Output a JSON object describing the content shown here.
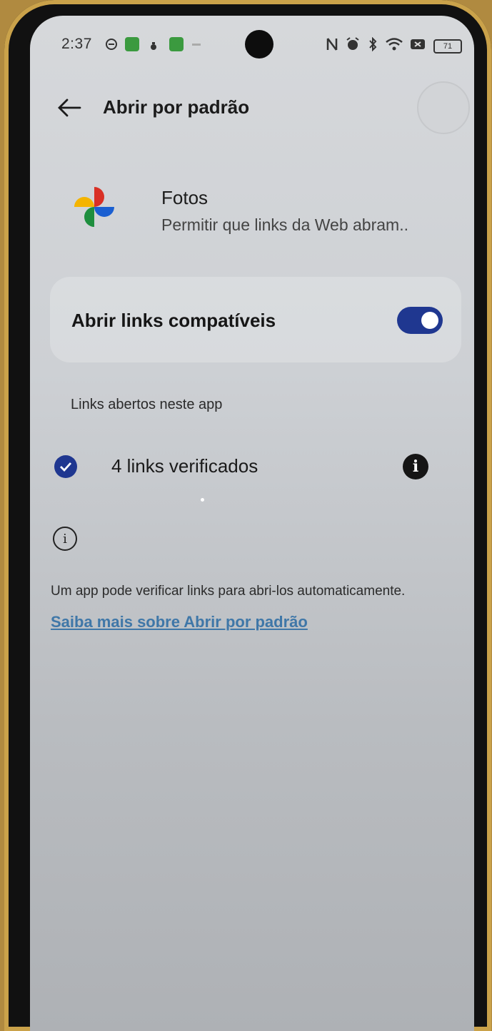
{
  "status_bar": {
    "time": "2:37",
    "battery": "71",
    "icons": [
      "notification-icon",
      "app-green-icon",
      "alarm-small-icon",
      "app-green-icon",
      "nfc-icon",
      "alarm-clock-icon",
      "bluetooth-icon",
      "wifi-icon",
      "data-icon",
      "battery-icon"
    ]
  },
  "app_bar": {
    "title": "Abrir por padrão",
    "back_icon": "arrow-left-icon"
  },
  "app": {
    "name": "Fotos",
    "description": "Permitir que links da Web abram..",
    "icon": "google-photos-icon"
  },
  "toggle": {
    "label": "Abrir links compatíveis",
    "on": true,
    "accent": "#1f3790"
  },
  "links_section": {
    "header": "Links abertos neste app",
    "verified_label": "4 links verificados"
  },
  "footer": {
    "info_text": "Um app pode verificar links para abri-los automaticamente.",
    "learn_more": "Saiba mais sobre Abrir por padrão",
    "link_color": "#3f77a8"
  }
}
